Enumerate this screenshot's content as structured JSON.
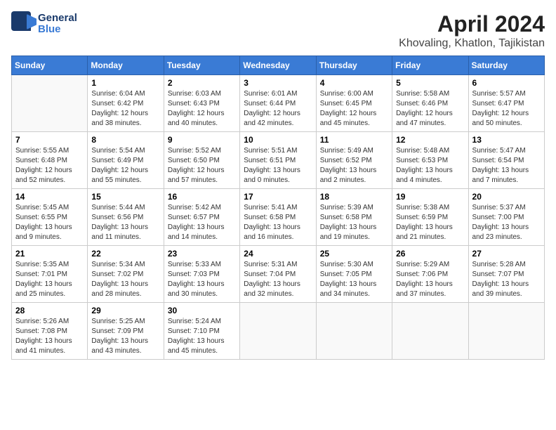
{
  "logo": {
    "line1": "General",
    "line2": "Blue"
  },
  "title": "April 2024",
  "location": "Khovaling, Khatlon, Tajikistan",
  "weekdays": [
    "Sunday",
    "Monday",
    "Tuesday",
    "Wednesday",
    "Thursday",
    "Friday",
    "Saturday"
  ],
  "weeks": [
    [
      {
        "day": "",
        "info": ""
      },
      {
        "day": "1",
        "info": "Sunrise: 6:04 AM\nSunset: 6:42 PM\nDaylight: 12 hours\nand 38 minutes."
      },
      {
        "day": "2",
        "info": "Sunrise: 6:03 AM\nSunset: 6:43 PM\nDaylight: 12 hours\nand 40 minutes."
      },
      {
        "day": "3",
        "info": "Sunrise: 6:01 AM\nSunset: 6:44 PM\nDaylight: 12 hours\nand 42 minutes."
      },
      {
        "day": "4",
        "info": "Sunrise: 6:00 AM\nSunset: 6:45 PM\nDaylight: 12 hours\nand 45 minutes."
      },
      {
        "day": "5",
        "info": "Sunrise: 5:58 AM\nSunset: 6:46 PM\nDaylight: 12 hours\nand 47 minutes."
      },
      {
        "day": "6",
        "info": "Sunrise: 5:57 AM\nSunset: 6:47 PM\nDaylight: 12 hours\nand 50 minutes."
      }
    ],
    [
      {
        "day": "7",
        "info": "Sunrise: 5:55 AM\nSunset: 6:48 PM\nDaylight: 12 hours\nand 52 minutes."
      },
      {
        "day": "8",
        "info": "Sunrise: 5:54 AM\nSunset: 6:49 PM\nDaylight: 12 hours\nand 55 minutes."
      },
      {
        "day": "9",
        "info": "Sunrise: 5:52 AM\nSunset: 6:50 PM\nDaylight: 12 hours\nand 57 minutes."
      },
      {
        "day": "10",
        "info": "Sunrise: 5:51 AM\nSunset: 6:51 PM\nDaylight: 13 hours\nand 0 minutes."
      },
      {
        "day": "11",
        "info": "Sunrise: 5:49 AM\nSunset: 6:52 PM\nDaylight: 13 hours\nand 2 minutes."
      },
      {
        "day": "12",
        "info": "Sunrise: 5:48 AM\nSunset: 6:53 PM\nDaylight: 13 hours\nand 4 minutes."
      },
      {
        "day": "13",
        "info": "Sunrise: 5:47 AM\nSunset: 6:54 PM\nDaylight: 13 hours\nand 7 minutes."
      }
    ],
    [
      {
        "day": "14",
        "info": "Sunrise: 5:45 AM\nSunset: 6:55 PM\nDaylight: 13 hours\nand 9 minutes."
      },
      {
        "day": "15",
        "info": "Sunrise: 5:44 AM\nSunset: 6:56 PM\nDaylight: 13 hours\nand 11 minutes."
      },
      {
        "day": "16",
        "info": "Sunrise: 5:42 AM\nSunset: 6:57 PM\nDaylight: 13 hours\nand 14 minutes."
      },
      {
        "day": "17",
        "info": "Sunrise: 5:41 AM\nSunset: 6:58 PM\nDaylight: 13 hours\nand 16 minutes."
      },
      {
        "day": "18",
        "info": "Sunrise: 5:39 AM\nSunset: 6:58 PM\nDaylight: 13 hours\nand 19 minutes."
      },
      {
        "day": "19",
        "info": "Sunrise: 5:38 AM\nSunset: 6:59 PM\nDaylight: 13 hours\nand 21 minutes."
      },
      {
        "day": "20",
        "info": "Sunrise: 5:37 AM\nSunset: 7:00 PM\nDaylight: 13 hours\nand 23 minutes."
      }
    ],
    [
      {
        "day": "21",
        "info": "Sunrise: 5:35 AM\nSunset: 7:01 PM\nDaylight: 13 hours\nand 25 minutes."
      },
      {
        "day": "22",
        "info": "Sunrise: 5:34 AM\nSunset: 7:02 PM\nDaylight: 13 hours\nand 28 minutes."
      },
      {
        "day": "23",
        "info": "Sunrise: 5:33 AM\nSunset: 7:03 PM\nDaylight: 13 hours\nand 30 minutes."
      },
      {
        "day": "24",
        "info": "Sunrise: 5:31 AM\nSunset: 7:04 PM\nDaylight: 13 hours\nand 32 minutes."
      },
      {
        "day": "25",
        "info": "Sunrise: 5:30 AM\nSunset: 7:05 PM\nDaylight: 13 hours\nand 34 minutes."
      },
      {
        "day": "26",
        "info": "Sunrise: 5:29 AM\nSunset: 7:06 PM\nDaylight: 13 hours\nand 37 minutes."
      },
      {
        "day": "27",
        "info": "Sunrise: 5:28 AM\nSunset: 7:07 PM\nDaylight: 13 hours\nand 39 minutes."
      }
    ],
    [
      {
        "day": "28",
        "info": "Sunrise: 5:26 AM\nSunset: 7:08 PM\nDaylight: 13 hours\nand 41 minutes."
      },
      {
        "day": "29",
        "info": "Sunrise: 5:25 AM\nSunset: 7:09 PM\nDaylight: 13 hours\nand 43 minutes."
      },
      {
        "day": "30",
        "info": "Sunrise: 5:24 AM\nSunset: 7:10 PM\nDaylight: 13 hours\nand 45 minutes."
      },
      {
        "day": "",
        "info": ""
      },
      {
        "day": "",
        "info": ""
      },
      {
        "day": "",
        "info": ""
      },
      {
        "day": "",
        "info": ""
      }
    ]
  ]
}
